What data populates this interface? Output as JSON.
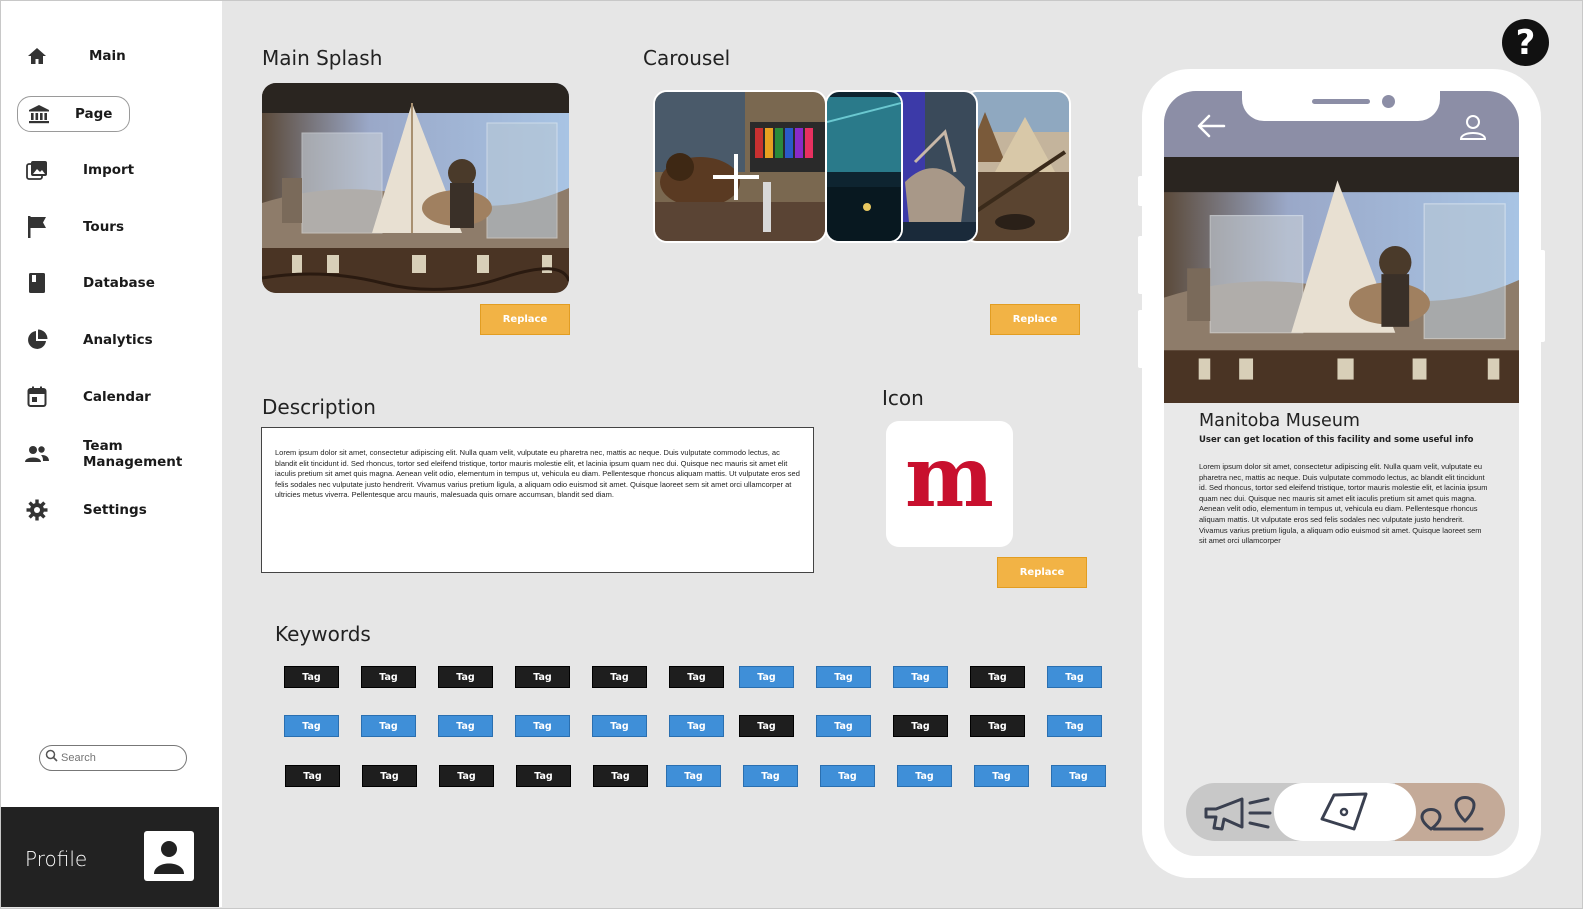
{
  "sidebar": {
    "items": [
      {
        "label": "Main",
        "icon": "home-icon"
      },
      {
        "label": "Page",
        "icon": "bank-icon"
      },
      {
        "label": "Import",
        "icon": "image-icon"
      },
      {
        "label": "Tours",
        "icon": "flag-icon"
      },
      {
        "label": "Database",
        "icon": "book-icon"
      },
      {
        "label": "Analytics",
        "icon": "pie-chart-icon"
      },
      {
        "label": "Calendar",
        "icon": "calendar-icon"
      },
      {
        "label": "Team Management",
        "icon": "people-icon"
      },
      {
        "label": "Settings",
        "icon": "gear-icon"
      }
    ],
    "active": "Page",
    "search_placeholder": "Search",
    "profile_label": "Profile"
  },
  "main": {
    "splash_title": "Main Splash",
    "carousel_title": "Carousel",
    "description_title": "Description",
    "description_text": "Lorem ipsum dolor sit amet, consectetur adipiscing elit. Nulla quam velit, vulputate eu pharetra nec, mattis ac neque. Duis vulputate commodo lectus, ac blandit elit tincidunt id. Sed rhoncus, tortor sed eleifend tristique, tortor mauris molestie elit, et lacinia ipsum quam nec dui. Quisque nec mauris sit amet elit iaculis pretium sit amet quis magna. Aenean velit odio, elementum in tempus ut, vehicula eu diam. Pellentesque rhoncus aliquam mattis. Ut vulputate eros sed felis sodales nec vulputate justo hendrerit. Vivamus varius pretium ligula, a aliquam odio euismod sit amet. Quisque laoreet sem sit amet orci ullamcorper at ultricies metus viverra. Pellentesque arcu mauris, malesuada quis ornare accumsan, blandit sed diam.",
    "icon_title": "Icon",
    "icon_letter": "m",
    "replace_label": "Replace",
    "keywords_title": "Keywords",
    "tag_label": "Tag",
    "tag_rows": [
      [
        "dark",
        "dark",
        "dark",
        "dark",
        "dark",
        "dark",
        "blue",
        "blue",
        "blue",
        "dark",
        "blue"
      ],
      [
        "blue",
        "blue",
        "blue",
        "blue",
        "blue",
        "blue",
        "dark",
        "blue",
        "dark",
        "dark",
        "blue"
      ],
      [
        "dark",
        "dark",
        "dark",
        "dark",
        "dark",
        "blue",
        "blue",
        "blue",
        "blue",
        "blue",
        "blue"
      ]
    ]
  },
  "help_label": "?",
  "phone": {
    "title": "Manitoba Museum",
    "subtitle": "User can get location of this facility and some useful info",
    "body": "Lorem ipsum dolor sit amet, consectetur adipiscing elit. Nulla quam velit, vulputate eu pharetra nec, mattis ac neque. Duis vulputate commodo lectus, ac blandit elit tincidunt id. Sed rhoncus, tortor sed eleifend tristique, tortor mauris molestie elit, et lacinia ipsum quam nec dui. Quisque nec mauris sit amet elit iaculis pretium sit amet quis magna. Aenean velit odio, elementum in tempus ut, vehicula eu diam. Pellentesque rhoncus aliquam mattis. Ut vulputate eros sed felis sodales nec vulputate justo hendrerit. Vivamus varius pretium ligula, a aliquam odio euismod sit amet. Quisque laoreet sem sit amet orci ullamcorper"
  },
  "colors": {
    "accent_orange": "#f2b345",
    "tag_blue": "#3f8fd8",
    "tag_dark": "#1e1e1e",
    "phone_header": "#8c8ea6",
    "brand_red": "#c8102e"
  }
}
